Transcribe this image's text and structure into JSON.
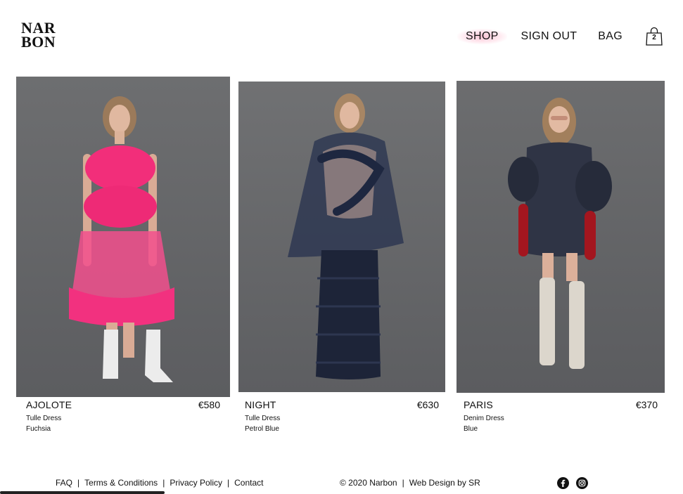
{
  "brand": {
    "line1": "NAR",
    "line2": "BON"
  },
  "nav": {
    "shop": "SHOP",
    "signout": "SIGN OUT",
    "bag": "BAG",
    "bag_count": "2"
  },
  "products": [
    {
      "name": "AJOLOTE",
      "price": "€580",
      "type": "Tulle Dress",
      "color": "Fuchsia"
    },
    {
      "name": "NIGHT",
      "price": "€630",
      "type": "Tulle Dress",
      "color": "Petrol Blue"
    },
    {
      "name": "PARIS",
      "price": "€370",
      "type": "Denim Dress",
      "color": "Blue"
    }
  ],
  "footer": {
    "faq": "FAQ",
    "terms": "Terms & Conditions",
    "privacy": "Privacy Policy",
    "contact": "Contact",
    "sep": "|",
    "copyright": "© 2020 Narbon",
    "credit": "Web Design by SR"
  },
  "icons": {
    "bag": "shopping-bag-icon",
    "facebook": "facebook-icon",
    "instagram": "instagram-icon"
  },
  "colors": {
    "shop_highlight": "#ffb3c8",
    "photo_bg": "#6b6c6e"
  }
}
